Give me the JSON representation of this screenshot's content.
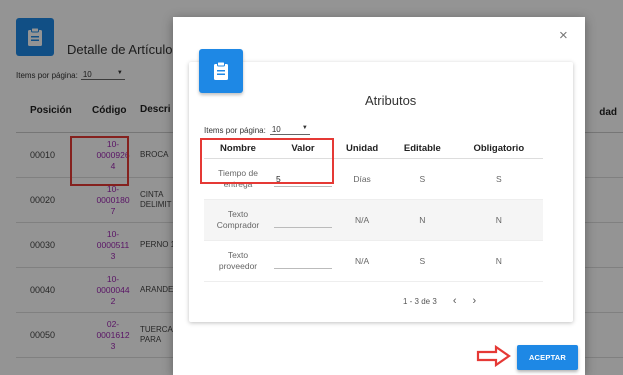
{
  "background": {
    "title": "Detalle de Artículo",
    "items_per_page_label": "Items por página:",
    "items_per_page_value": "10",
    "columns": [
      "Posición",
      "Código",
      "Descri"
    ],
    "right_column": "dad",
    "rows": [
      {
        "pos": "00010",
        "code": [
          "10-",
          "0000926",
          "4"
        ],
        "desc": [
          "BROCA"
        ]
      },
      {
        "pos": "00020",
        "code": [
          "10-",
          "0000180",
          "7"
        ],
        "desc": [
          "CINTA",
          "DELIMIT",
          ""
        ]
      },
      {
        "pos": "00030",
        "code": [
          "10-",
          "0000511",
          "3"
        ],
        "desc": [
          "PERNO 1"
        ]
      },
      {
        "pos": "00040",
        "code": [
          "10-",
          "0000044",
          "2"
        ],
        "desc": [
          "ARANDE"
        ]
      },
      {
        "pos": "00050",
        "code": [
          "02-",
          "0001612",
          "3"
        ],
        "desc": [
          "TUERCA",
          "PARA"
        ]
      }
    ]
  },
  "modal": {
    "title": "Atributos",
    "close_glyph": "×",
    "items_per_page_label": "Items por página:",
    "items_per_page_value": "10",
    "dropdown_glyph": "▼",
    "columns": [
      "Nombre",
      "Valor",
      "Unidad",
      "Editable",
      "Obligatorio"
    ],
    "rows": [
      {
        "nombre": [
          "Tiempo de",
          "entrega"
        ],
        "valor": "5",
        "unidad": "Días",
        "editable": "S",
        "obligatorio": "S"
      },
      {
        "nombre": [
          "Texto",
          "Comprador"
        ],
        "valor": "",
        "unidad": "N/A",
        "editable": "N",
        "obligatorio": "N"
      },
      {
        "nombre": [
          "Texto",
          "proveedor"
        ],
        "valor": "",
        "unidad": "N/A",
        "editable": "S",
        "obligatorio": "N"
      }
    ],
    "pagination": {
      "range": "1 - 3 de 3",
      "prev": "‹",
      "next": "›"
    },
    "accept_label": "ACEPTAR"
  },
  "colors": {
    "accent": "#1e88e5",
    "highlight": "#e53935",
    "code_link": "#9c27b0"
  }
}
